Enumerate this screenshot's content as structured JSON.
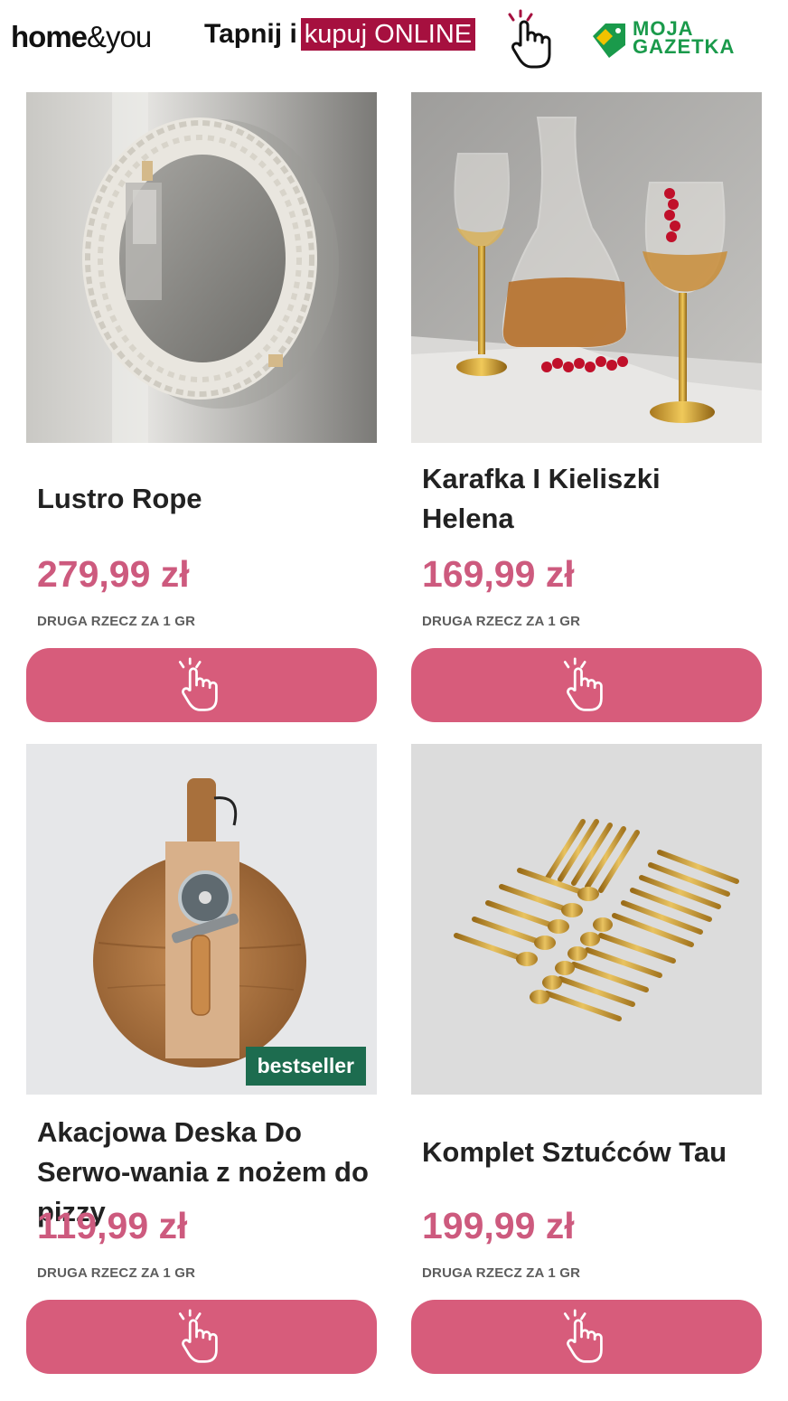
{
  "header": {
    "logo_home": "home",
    "logo_you": "&you",
    "tap_text": "Tapnij i",
    "tap_highlight": "kupuj ONLINE",
    "gazetka_line1": "MOJA",
    "gazetka_line2": "GAZETKA"
  },
  "colors": {
    "accent_pink": "#d75c7b",
    "price_pink": "#cd5a7e",
    "highlight_red": "#a6103f",
    "gazetka_green": "#1a9a4b",
    "badge_green": "#1d6c4f"
  },
  "products": [
    {
      "name": "Lustro Rope",
      "price": "279,99 zł",
      "promo": "DRUGA RZECZ ZA 1 GR",
      "image": "round-rope-mirror",
      "button_icon": "tap-hand-icon"
    },
    {
      "name": "Karafka I Kieliszki Helena",
      "price": "169,99 zł",
      "promo": "DRUGA RZECZ ZA 1 GR",
      "image": "carafe-and-gold-glasses",
      "button_icon": "tap-hand-icon"
    },
    {
      "name": "Akacjowa Deska Do Serwo-wania z nożem do pizzy",
      "price": "119,99 zł",
      "promo": "DRUGA RZECZ ZA 1 GR",
      "badge": "bestseller",
      "image": "acacia-board-with-pizza-cutter",
      "button_icon": "tap-hand-icon"
    },
    {
      "name": "Komplet Sztućców Tau",
      "price": "199,99 zł",
      "promo": "DRUGA RZECZ ZA 1 GR",
      "image": "gold-cutlery-set",
      "button_icon": "tap-hand-icon"
    }
  ]
}
